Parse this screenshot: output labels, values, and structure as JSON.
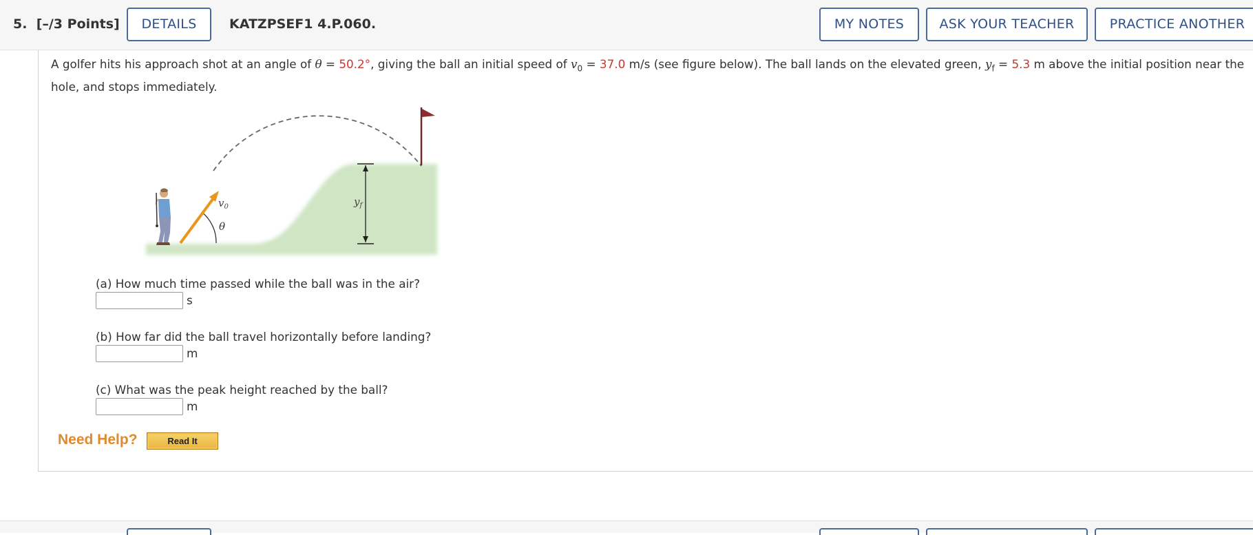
{
  "header": {
    "question_number": "5.",
    "points": "[–/3 Points]",
    "details_label": "DETAILS",
    "question_code": "KATZPSEF1 4.P.060.",
    "my_notes_label": "MY NOTES",
    "ask_teacher_label": "ASK YOUR TEACHER",
    "practice_label": "PRACTICE ANOTHER"
  },
  "stem": {
    "part1": "A golfer hits his approach shot at an angle of ",
    "theta_symbol": "θ",
    "eq1": " = ",
    "theta_value": "50.2°",
    "part2": ",  giving the ball an initial speed of ",
    "v0_symbol": "v",
    "v0_sub": "0",
    "eq2": " = ",
    "v0_value": "37.0",
    "part3": " m/s  (see figure below). The ball lands on the elevated green, ",
    "yf_symbol": "y",
    "yf_sub": "f",
    "eq3": " = ",
    "yf_value": "5.3",
    "part4": " m  above the initial position near the hole, and stops immediately."
  },
  "figure": {
    "label_v0": "v",
    "label_v0_sub": "0",
    "label_theta": "θ",
    "label_yf": "y",
    "label_yf_sub": "f",
    "icons": [
      "golfer-figure",
      "flag-icon",
      "arrow-icon"
    ],
    "colors": {
      "green": "#cfe5c4",
      "arrow": "#e8961e",
      "flag": "#8e2a32",
      "dashed_path": "#666666"
    }
  },
  "questions": [
    {
      "text": "(a) How much time passed while the ball was in the air?",
      "value": "",
      "unit": "s"
    },
    {
      "text": "(b) How far did the ball travel horizontally before landing?",
      "value": "",
      "unit": "m"
    },
    {
      "text": "(c) What was the peak height reached by the ball?",
      "value": "",
      "unit": "m"
    }
  ],
  "help": {
    "label": "Need Help?",
    "read_it_label": "Read It"
  },
  "colors": {
    "accent": "#2f4f86",
    "given_value": "#d0342c",
    "need_help": "#e08a2c"
  }
}
